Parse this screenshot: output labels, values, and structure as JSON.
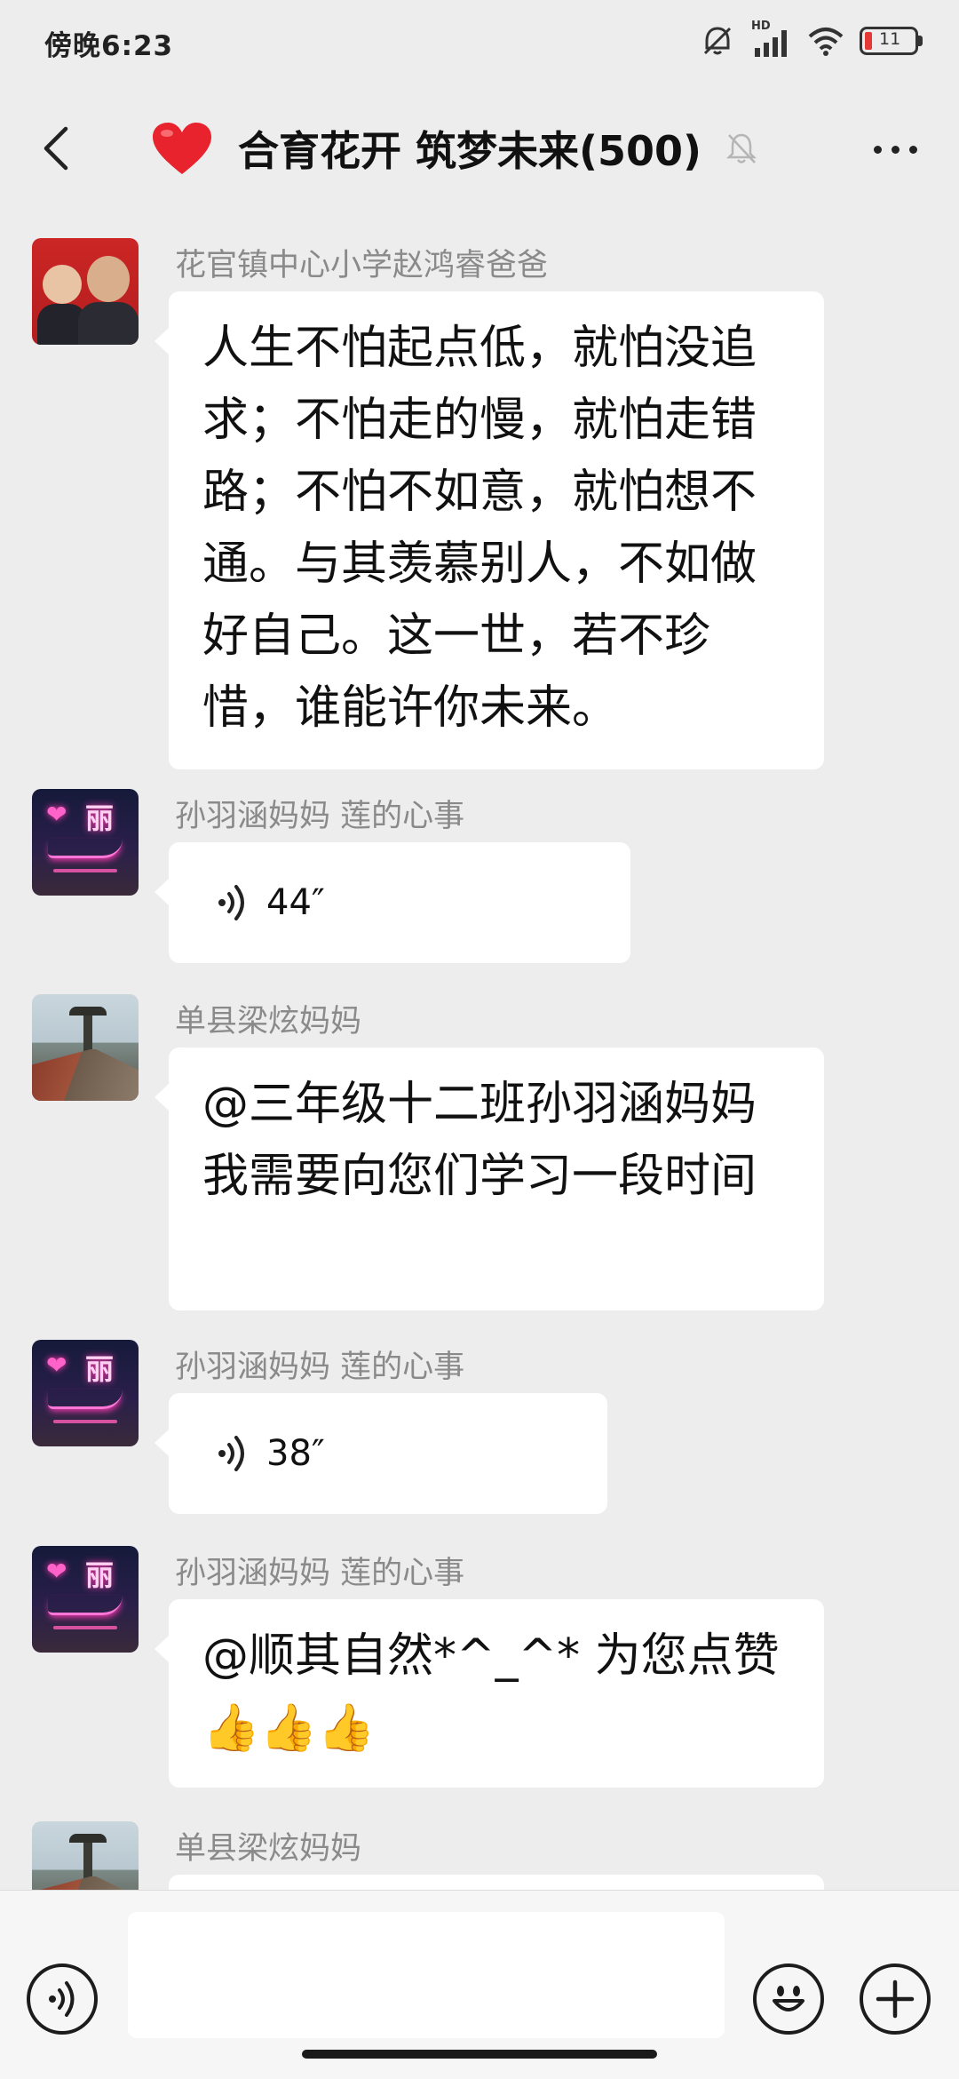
{
  "status_bar": {
    "time": "傍晚6:23",
    "network_label": "HD",
    "battery_level": "11",
    "icons": [
      "mute-alarm-icon",
      "signal-icon",
      "wifi-icon",
      "battery-icon"
    ]
  },
  "header": {
    "title": "合育花开 筑梦未来(500)",
    "title_emoji": "heart-icon",
    "back_icon": "back-chevron-icon",
    "mute_icon": "mute-bell-icon",
    "more_icon": "more-dots-icon"
  },
  "messages": [
    {
      "sender": "花官镇中心小学赵鸿睿爸爸",
      "type": "text",
      "text": "人生不怕起点低，就怕没追求；不怕走的慢，就怕走错路；不怕不如意，就怕想不通。与其羡慕别人，不如做好自己。这一世，若不珍惜，谁能许你未来。"
    },
    {
      "sender": "孙羽涵妈妈  莲的心事",
      "type": "voice",
      "duration": "44″"
    },
    {
      "sender": "单县梁炫妈妈",
      "type": "text",
      "text": "@三年级十二班孙羽涵妈妈 我需要向您们学习一段时间"
    },
    {
      "sender": "孙羽涵妈妈  莲的心事",
      "type": "voice",
      "duration": "38″"
    },
    {
      "sender": "孙羽涵妈妈  莲的心事",
      "type": "text",
      "text": "@顺其自然*^_^* 为您点赞",
      "emoji": "👍👍👍"
    },
    {
      "sender": "单县梁炫妈妈",
      "type": "partial"
    }
  ],
  "avatars": {
    "neon_char": "丽"
  },
  "input_bar": {
    "placeholder": "",
    "voice_icon": "voice-input-icon",
    "emoji_icon": "emoji-icon",
    "plus_icon": "plus-icon"
  },
  "colors": {
    "background": "#ededed",
    "bubble": "#ffffff",
    "sender_text": "#8a8a8a",
    "battery_low": "#e53935",
    "heart": "#e8232e"
  }
}
